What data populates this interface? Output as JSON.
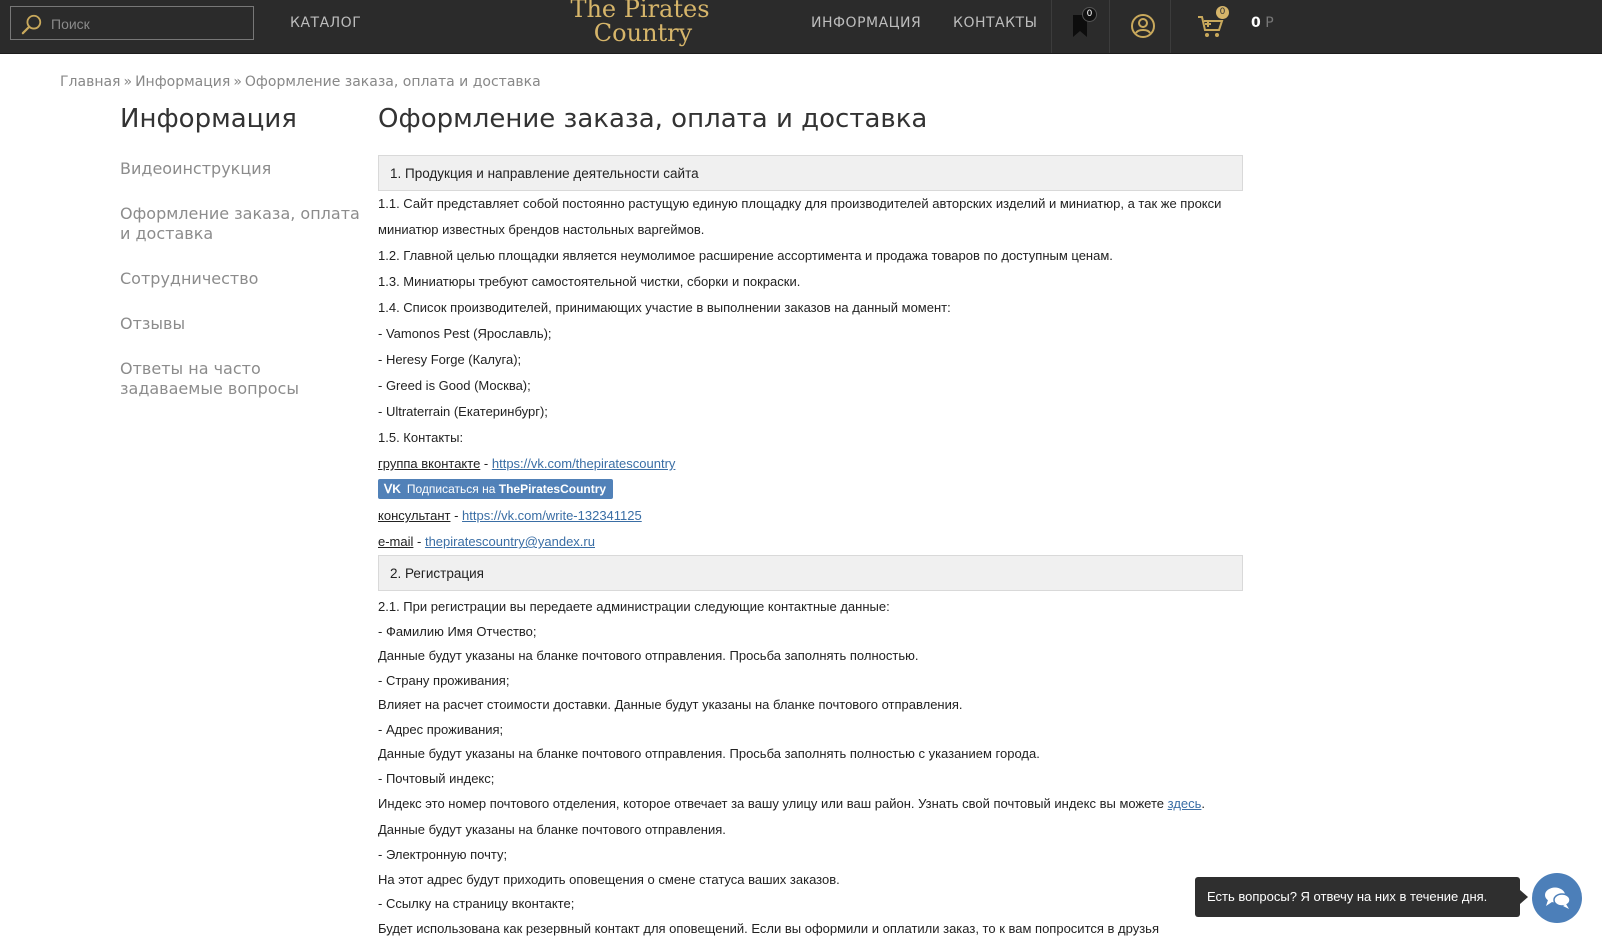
{
  "header": {
    "search_placeholder": "Поиск",
    "catalog": "КАТАЛОГ",
    "logo_line1": "The Pirates",
    "logo_line2": "Country",
    "info": "ИНФОРМАЦИЯ",
    "contacts": "КОНТАКТЫ",
    "bookmark_count": "0",
    "cart_count": "0",
    "cart_total": "0",
    "cart_currency": "Р",
    "colors": {
      "bar": "#2b2b2b",
      "gold": "#d6b56a"
    }
  },
  "breadcrumb": {
    "items": [
      "Главная",
      "Информация",
      "Оформление заказа, оплата и доставка"
    ],
    "separator": "»"
  },
  "sidebar": {
    "title": "Информация",
    "items": [
      "Видеоинструкция",
      "Оформление заказа, оплата и доставка",
      "Сотрудничество",
      "Отзывы",
      "Ответы на часто задаваемые вопросы"
    ]
  },
  "main": {
    "title": "Оформление заказа, оплата и доставка",
    "section1": {
      "heading": "1. Продукция и направление деятельности сайта",
      "p1_1": "1.1. Сайт представляет собой постоянно растущую единую площадку для производителей авторских изделий и миниатюр, а так же прокси миниатюр известных брендов настольных варгеймов.",
      "p1_2": "1.2. Главной целью площадки является неумолимое расширение ассортимента и продажа товаров по доступным ценам.",
      "p1_3": "1.3. Миниатюры требуют самостоятельной чистки, сборки и покраски.",
      "p1_4": "1.4. Список производителей, принимающих участие в выполнении заказов на данный момент:",
      "makers": [
        "- Vamonos Pest (Ярославль);",
        "- Heresy Forge (Калуга);",
        "- Greed is Good (Москва);",
        "- Ultraterrain (Екатеринбург);"
      ],
      "p1_5": "1.5. Контакты:",
      "vk_group_label": "группа вконтакте",
      "vk_group_url": "https://vk.com/thepiratescountry",
      "vk_button_prefix": "Подписаться на",
      "vk_button_name": "ThePiratesCountry",
      "consultant_label": "консультант",
      "consultant_url": "https://vk.com/write-132341125",
      "email_label": "e-mail",
      "email": "thepiratescountry@yandex.ru",
      "dash": " - "
    },
    "section2": {
      "heading": "2. Регистрация",
      "lines": [
        "2.1. При регистрации вы передаете администрации следующие контактные данные:",
        "- Фамилию Имя Отчество;",
        "Данные будут указаны на бланке почтового отправления. Просьба заполнять полностью.",
        "- Страну проживания;",
        "Влияет на расчет стоимости доставки. Данные будут указаны на бланке почтового отправления.",
        "- Адрес проживания;",
        "Данные будут указаны на бланке почтового отправления. Просьба заполнять полностью с указанием города.",
        "- Почтовый индекс;"
      ],
      "index_text_1": "Индекс это номер почтового отделения, которое отвечает за вашу улицу или ваш район. Узнать свой почтовый индекс вы можете",
      "index_link": "здесь",
      "index_text_2": ". Данные будут указаны на бланке почтового отправления.",
      "lines_after": [
        "- Электронную почту;",
        "На этот адрес будут приходить оповещения о смене статуса ваших заказов.",
        "- Ссылку на страницу вконтакте;",
        "Будет использована как резервный контакт для оповещений. Если вы оформили и оплатили заказ, то к вам попросится в друзья"
      ]
    }
  },
  "chat": {
    "tooltip": "Есть вопросы? Я отвечу на них в течение дня.",
    "color": "#4c7fb9"
  }
}
